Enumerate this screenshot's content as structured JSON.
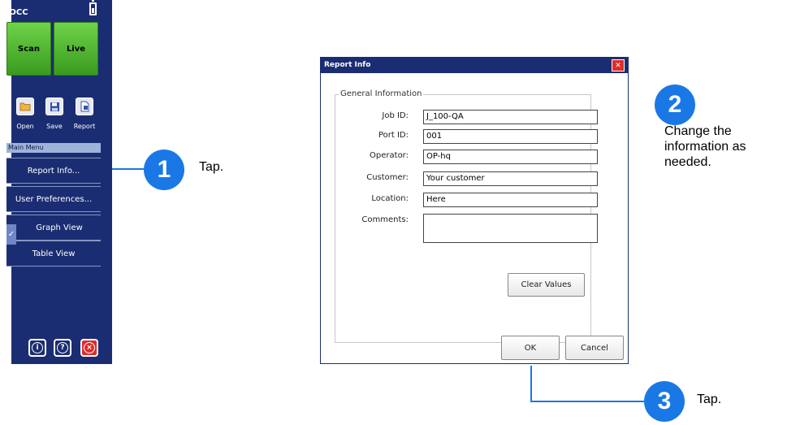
{
  "panel": {
    "title": "iOCC",
    "scan_label": "Scan",
    "live_label": "Live",
    "toolbar": [
      {
        "label": "Open",
        "icon": "folder-icon"
      },
      {
        "label": "Save",
        "icon": "floppy-icon"
      },
      {
        "label": "Report",
        "icon": "report-icon"
      }
    ],
    "menu_header": "Main Menu",
    "menu_items": [
      {
        "label": "Report Info..."
      },
      {
        "label": "User Preferences..."
      },
      {
        "label": "Graph View",
        "checked": true
      },
      {
        "label": "Table View"
      }
    ],
    "bottom_icons": [
      "info-icon",
      "help-icon",
      "exit-icon"
    ]
  },
  "dialog": {
    "title": "Report Info",
    "group_title": "General Information",
    "fields": [
      {
        "label": "Job ID:",
        "value": "J_100-QA"
      },
      {
        "label": "Port ID:",
        "value": "001"
      },
      {
        "label": "Operator:",
        "value": "OP-hq"
      },
      {
        "label": "Customer:",
        "value": "Your customer"
      },
      {
        "label": "Location:",
        "value": "Here"
      },
      {
        "label": "Comments:",
        "value": ""
      }
    ],
    "clear_label": "Clear Values",
    "ok_label": "OK",
    "cancel_label": "Cancel"
  },
  "callouts": [
    {
      "number": "1",
      "text": "Tap."
    },
    {
      "number": "2",
      "text": "Change the information as needed."
    },
    {
      "number": "3",
      "text": "Tap."
    }
  ],
  "colors": {
    "panel": "#1b2d72",
    "accent": "#1a78e6",
    "green": "#4fb52b",
    "close": "#e02c2c"
  }
}
